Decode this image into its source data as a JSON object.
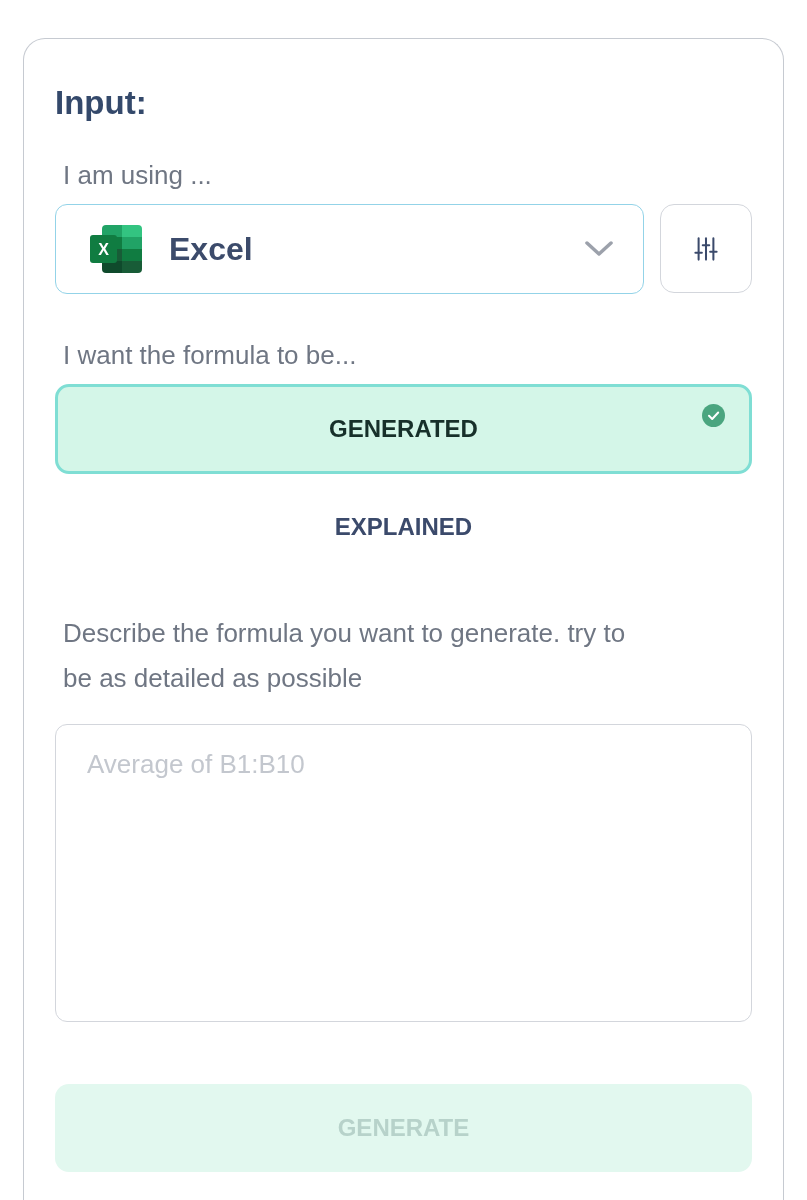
{
  "title": "Input:",
  "app_select": {
    "label": "I am using ...",
    "icon_letter": "X",
    "value": "Excel"
  },
  "mode": {
    "label": "I want the formula to be...",
    "options": [
      {
        "label": "GENERATED",
        "selected": true
      },
      {
        "label": "EXPLAINED",
        "selected": false
      }
    ]
  },
  "description": {
    "label": "Describe the formula you want to generate. try to be as detailed as possible",
    "placeholder": "Average of B1:B10"
  },
  "submit": {
    "label": "GENERATE",
    "disabled": true
  }
}
